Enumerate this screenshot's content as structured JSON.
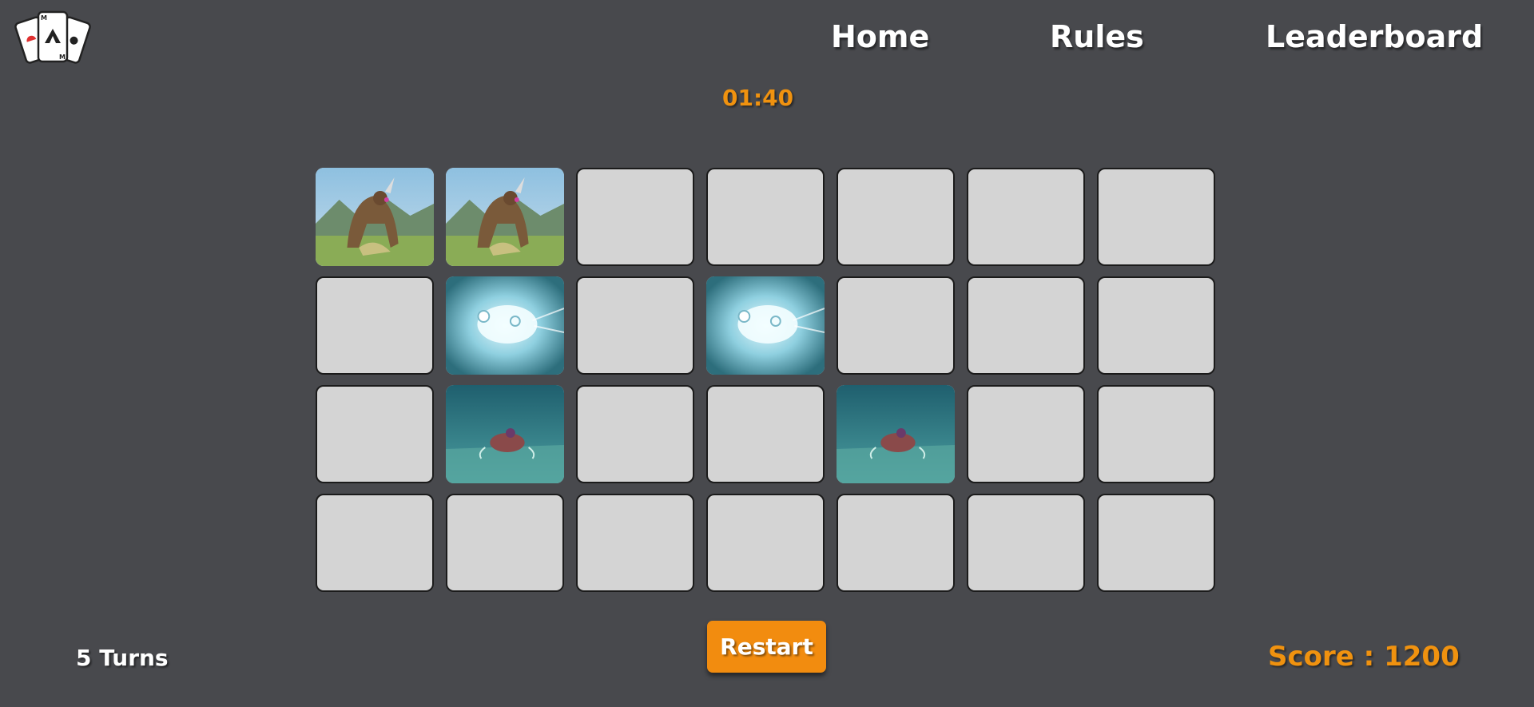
{
  "app": {
    "logo_icon": "playing-cards-logo-icon"
  },
  "nav": {
    "home": "Home",
    "rules": "Rules",
    "leaderboard": "Leaderboard"
  },
  "game": {
    "timer": "01:40",
    "turns": "5 Turns",
    "restart_label": "Restart",
    "score": "Score : 1200",
    "board": {
      "columns": 7,
      "rows": 4,
      "cards": [
        "lynel",
        "lynel",
        "hidden",
        "hidden",
        "hidden",
        "hidden",
        "hidden",
        "hidden",
        "spirit",
        "hidden",
        "spirit",
        "hidden",
        "hidden",
        "hidden",
        "hidden",
        "guardian",
        "hidden",
        "hidden",
        "guardian",
        "hidden",
        "hidden",
        "hidden",
        "hidden",
        "hidden",
        "hidden",
        "hidden",
        "hidden",
        "hidden"
      ]
    }
  },
  "colors": {
    "background": "#48494d",
    "accent": "#f0920f",
    "card_back": "#d4d4d4",
    "card_border": "#1b1b1b"
  }
}
